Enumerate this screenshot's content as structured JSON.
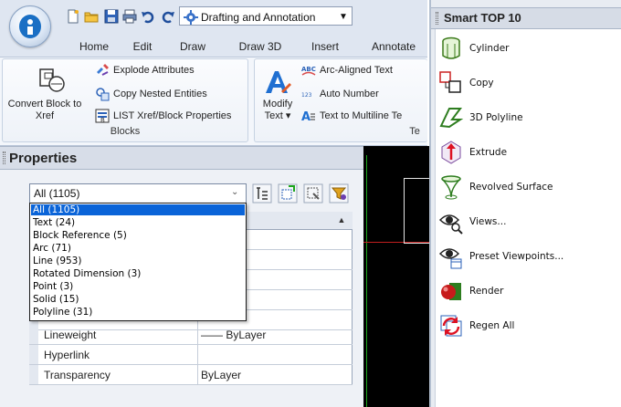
{
  "quick_access": {
    "workspace": "Drafting and Annotation"
  },
  "ribbon": {
    "tabs": [
      "Home",
      "Edit",
      "Draw",
      "Draw 3D",
      "Insert",
      "Annotate"
    ],
    "blocks_group": {
      "label": "Blocks",
      "convert_label": "Convert Block to Xref",
      "explode_label": "Explode Attributes",
      "copy_nested_label": "Copy Nested Entities",
      "list_label": "LIST Xref/Block Properties"
    },
    "text_group": {
      "label": "Te",
      "modify_label": "Modify Text ▾",
      "arc_text_label": "Arc-Aligned Text",
      "auto_number_label": "Auto Number",
      "to_multiline_label": "Text to Multiline Te"
    }
  },
  "properties": {
    "title": "Properties",
    "filter_value": "All (1105)",
    "filter_options": [
      "All (1105)",
      "Text (24)",
      "Block Reference (5)",
      "Arc (71)",
      "Line (953)",
      "Rotated Dimension (3)",
      "Point (3)",
      "Solid (15)",
      "Polyline (31)"
    ],
    "selected_option_index": 0,
    "rows": [
      {
        "name": "Lineweight",
        "value": "—— ByLayer"
      },
      {
        "name": "Hyperlink",
        "value": ""
      },
      {
        "name": "Transparency",
        "value": "ByLayer"
      }
    ]
  },
  "smart_top10": {
    "title": "Smart TOP 10",
    "items": [
      {
        "label": "Cylinder",
        "icon": "cylinder-icon"
      },
      {
        "label": "Copy",
        "icon": "copy-icon"
      },
      {
        "label": "3D Polyline",
        "icon": "3d-polyline-icon"
      },
      {
        "label": "Extrude",
        "icon": "extrude-icon"
      },
      {
        "label": "Revolved Surface",
        "icon": "revolved-surface-icon"
      },
      {
        "label": "Views...",
        "icon": "views-icon"
      },
      {
        "label": "Preset Viewpoints...",
        "icon": "preset-viewpoints-icon"
      },
      {
        "label": "Render",
        "icon": "render-icon"
      },
      {
        "label": "Regen All",
        "icon": "regen-all-icon"
      }
    ]
  },
  "colors": {
    "ribbon_bg": "#dfe6f1",
    "selection": "#0a64d8",
    "canvas": "#000000",
    "ucs_x_axis": "#c21e1e",
    "ucs_y_axis": "#1ca51c"
  }
}
